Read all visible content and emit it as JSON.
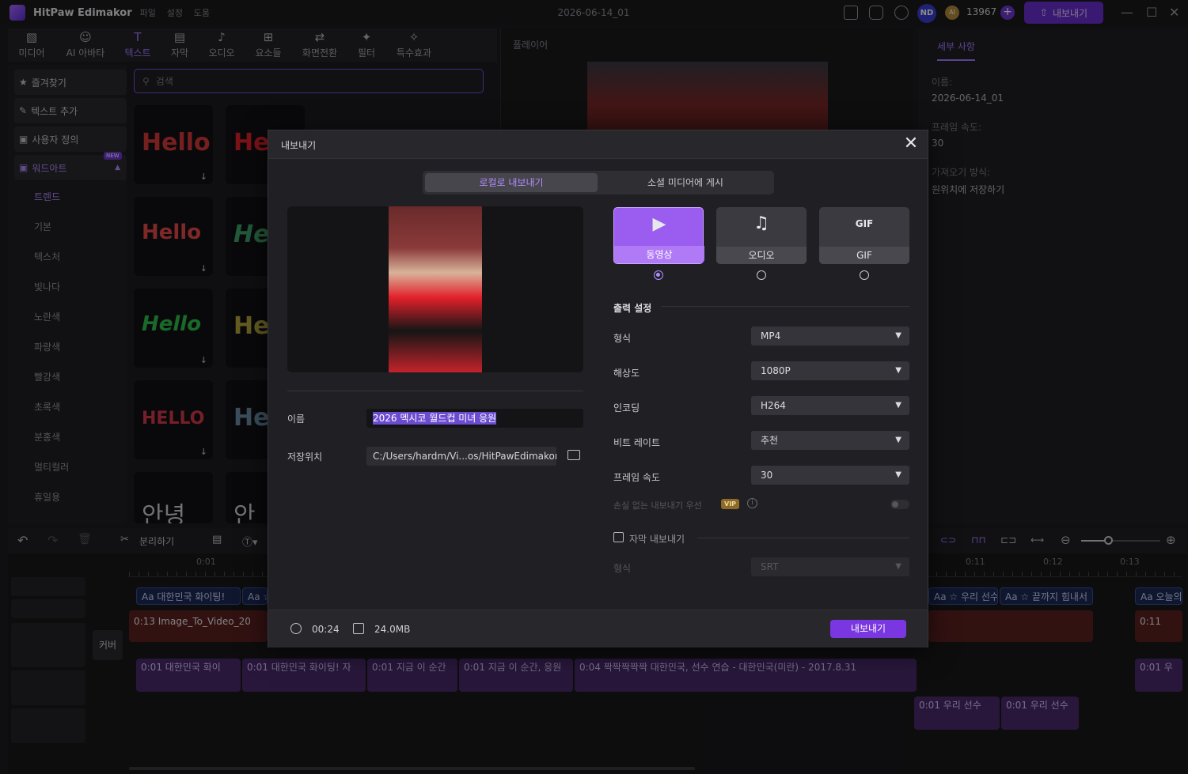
{
  "app": {
    "name": "HitPaw Edimakor",
    "menus": [
      "파일",
      "설정",
      "도움"
    ],
    "doc_title": "2026-06-14_01",
    "user_initials": "ND",
    "coin_label": "AI",
    "credits": "13967",
    "export_label": "내보내기"
  },
  "toolbar_tabs": [
    {
      "label": "미디어",
      "icon": "▧"
    },
    {
      "label": "AI 아바타",
      "icon": "☺"
    },
    {
      "label": "텍스트",
      "icon": "T"
    },
    {
      "label": "자막",
      "icon": "▤"
    },
    {
      "label": "오디오",
      "icon": "♪"
    },
    {
      "label": "요소들",
      "icon": "⊞"
    },
    {
      "label": "화면전환",
      "icon": "⇄"
    },
    {
      "label": "필터",
      "icon": "✦"
    },
    {
      "label": "특수효과",
      "icon": "✧"
    }
  ],
  "sidebar": {
    "items": [
      "즐겨찾기",
      "텍스트 추가",
      "사용자 정의",
      "워드아트"
    ],
    "new_badge": "NEW",
    "subitems": [
      "트렌드",
      "기본",
      "텍스처",
      "빛나다",
      "노란색",
      "파랑색",
      "빨강색",
      "초록색",
      "분홍색",
      "멀티컬러",
      "휴일용"
    ]
  },
  "search": {
    "placeholder": "검색"
  },
  "tiles": [
    {
      "text": "Hello",
      "color": "#d73a3a"
    },
    {
      "text": "Hell",
      "color": "#e0242a"
    },
    {
      "text": "Hello",
      "color": "#e84a4a"
    },
    {
      "text": "He",
      "color": "#3fa56b"
    },
    {
      "text": "Hello",
      "color": "#2fbf4a"
    },
    {
      "text": "He",
      "color": "#b7a840"
    },
    {
      "text": "HELLO",
      "color": "#d53a4a"
    },
    {
      "text": "He",
      "color": "#6b8ea8"
    },
    {
      "text": "안녕",
      "color": "#cfcfd4"
    },
    {
      "text": "안",
      "color": "#cfcfd4"
    }
  ],
  "player": {
    "title": "플레이어"
  },
  "details": {
    "tab": "세부 사항",
    "name_label": "이름:",
    "name_value": "2026-06-14_01",
    "fps_label": "프레임 속도:",
    "fps_value": "30",
    "import_label": "가져오기 방식:",
    "import_value": "원위치에 저장하기"
  },
  "timeline": {
    "split_label": "분리하기",
    "ruler": [
      "0:01",
      "0:11",
      "0:12",
      "0:13"
    ],
    "cover_label": "커버",
    "text_clips": [
      "Aa 대한민국 화이팅!",
      "Aa ☆",
      "Aa ☆ 우리 선수들",
      "Aa ☆ 끝까지 힘내서",
      "Aa 오늘의"
    ],
    "video_clips": [
      "0:13 Image_To_Video_20",
      "0:11"
    ],
    "audio_clips": [
      "0:01 대한민국 화이",
      "0:01 대한민국 화이팅! 자",
      "0:01 지금 이 순간",
      "0:01 지금 이 순간, 응원",
      "0:04 짝짝짝짝짝 대한민국, 선수 연습 - 대한민국(미란) - 2017.8.31",
      "0:01 우"
    ],
    "audio_clips2": [
      "0:01 우리 선수",
      "0:01 우리 선수"
    ]
  },
  "dialog": {
    "title": "내보내기",
    "tabs": [
      "로컬로 내보내기",
      "소셜 미디어에 게시"
    ],
    "name_label": "이름",
    "name_value": "2026 멕시코 월드컵 미녀 응원",
    "location_label": "저장위치",
    "location_value": "C:/Users/hardm/Vi...os/HitPawEdimakor",
    "formats": [
      {
        "label": "동영상",
        "icon": "▶",
        "selected": true
      },
      {
        "label": "오디오",
        "icon": "♫",
        "selected": false
      },
      {
        "label": "GIF",
        "icon": "GIF",
        "selected": false
      }
    ],
    "output_section": "출력 설정",
    "settings": [
      {
        "label": "형식",
        "value": "MP4"
      },
      {
        "label": "해상도",
        "value": "1080P"
      },
      {
        "label": "인코딩",
        "value": "H264"
      },
      {
        "label": "비트 레이트",
        "value": "추천"
      },
      {
        "label": "프레임 속도",
        "value": "30"
      }
    ],
    "lossless_label": "손실 없는 내보내기 우선",
    "vip_badge": "VIP",
    "subtitle_export_label": "자막 내보내기",
    "subtitle_format_label": "형식",
    "subtitle_format_value": "SRT",
    "duration": "00:24",
    "filesize": "24.0MB",
    "export_button": "내보내기"
  },
  "colors": {
    "accent": "#9b5cf0",
    "button": "#7a36e0"
  }
}
